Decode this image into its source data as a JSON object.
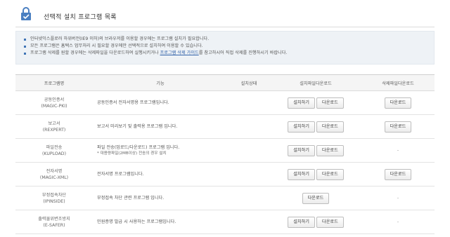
{
  "header": {
    "title": "선택적 설치 프로그램 목록",
    "icon": "shield-check-icon",
    "accent": "#3f74b6"
  },
  "notice": [
    "인터넷익스플로러 하위버전(IE9 이하)의 브라우저를 이용할 경우에는 프로그램 설치가 필요합니다.",
    "모든 프로그램은 홈택스 업무처리 시 필요할 경우에만 선택적으로 설치하여 이용할 수 있습니다."
  ],
  "notice3": {
    "before": "프로그램 삭제를 원할 경우에는 삭제파일을 다운로드하여 실행시키거나 ",
    "link": "프로그램 삭제 가이드",
    "after": "를 참고하시어 직접 삭제를 진행하시기 바랍니다."
  },
  "table": {
    "headers": [
      "프로그램명",
      "기능",
      "설치상태",
      "설치파일다운로드",
      "삭제파일다운로드"
    ],
    "install_label": "설치하기",
    "download_label": "다운로드",
    "dash": "-",
    "rows": [
      {
        "name": "공동인증서",
        "code": "(MAGIC-PKI)",
        "desc": "공동인증서 전자서명용 프로그램입니다.",
        "desc2": ""
      },
      {
        "name": "보고서",
        "code": "(REXPERT)",
        "desc": "보고서 미리보기 및 출력용 프로그램 입니다.",
        "desc2": ""
      },
      {
        "name": "파일전송",
        "code": "(KUPLOAD)",
        "desc": "파일 전송(업로드/다운로드) 프로그램 입니다.",
        "desc2": "* 대용량파일(2MB이상) 전송의 경우 설치"
      },
      {
        "name": "전자서명",
        "code": "(MAGIC-XML)",
        "desc": "전자서명 프로그램입니다.",
        "desc2": ""
      },
      {
        "name": "부정접속차단",
        "code": "(IPINSIDE)",
        "desc": "부정접속 차단 관련 프로그램 입니다.",
        "desc2": ""
      },
      {
        "name": "출력물위변조방지",
        "code": "(E-SAFER)",
        "desc": "민원증명 발급 시 사용하는 프로그램입니다.",
        "desc2": ""
      }
    ]
  }
}
